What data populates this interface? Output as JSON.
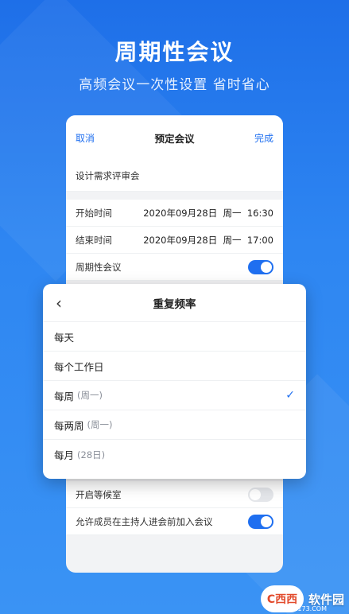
{
  "hero": {
    "title": "周期性会议",
    "subtitle": "高频会议一次性设置 省时省心"
  },
  "form": {
    "nav": {
      "cancel": "取消",
      "title": "预定会议",
      "done": "完成"
    },
    "meeting_name": "设计需求评审会",
    "start": {
      "label": "开始时间",
      "value": "2020年09月28日  周一  16:30"
    },
    "end": {
      "label": "结束时间",
      "value": "2020年09月28日  周一  17:00"
    },
    "recurring": {
      "label": "周期性会议",
      "on": true
    },
    "waiting_room": {
      "label": "开启等候室",
      "on": false
    },
    "join_before_host": {
      "label": "允许成员在主持人进会前加入会议",
      "on": true
    }
  },
  "sheet": {
    "title": "重复频率",
    "options": [
      {
        "label": "每天",
        "sub": "",
        "selected": false
      },
      {
        "label": "每个工作日",
        "sub": "",
        "selected": false
      },
      {
        "label": "每周",
        "sub": "(周一)",
        "selected": true
      },
      {
        "label": "每两周",
        "sub": "(周一)",
        "selected": false
      },
      {
        "label": "每月",
        "sub": "(28日)",
        "selected": false
      }
    ],
    "check_glyph": "✓"
  },
  "watermark": {
    "logo": "C西西",
    "text": "软件园",
    "url": "CR173.COM"
  },
  "colors": {
    "accent": "#1f6ff0",
    "background": "#2e86f2"
  }
}
